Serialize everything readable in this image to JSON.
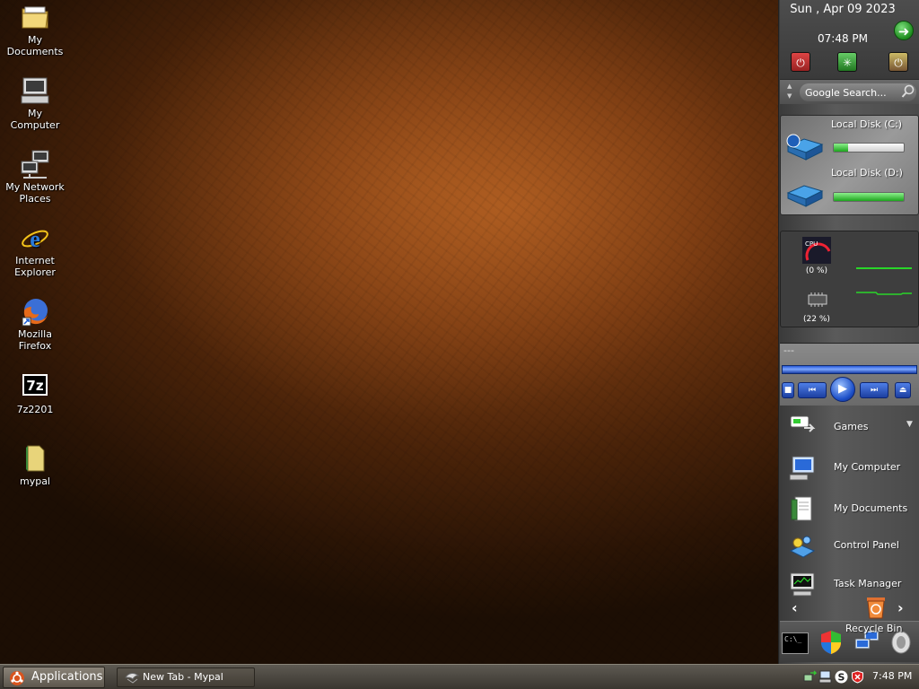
{
  "desktop": {
    "icons": [
      {
        "label": "My\nDocuments",
        "icon": "folder-icon"
      },
      {
        "label": "My\nComputer",
        "icon": "computer-icon"
      },
      {
        "label": "My Network\nPlaces",
        "icon": "network-icon"
      },
      {
        "label": "Internet\nExplorer",
        "icon": "internet-explorer-icon"
      },
      {
        "label": "Mozilla\nFirefox",
        "icon": "firefox-icon"
      },
      {
        "label": "7z2201",
        "icon": "7zip-icon"
      },
      {
        "label": "mypal",
        "icon": "file-icon"
      }
    ]
  },
  "sidebar": {
    "clock": {
      "date": "Sun , Apr 09 2023",
      "time": "07:48 PM"
    },
    "search": {
      "placeholder": "Google Search..."
    },
    "disks": [
      {
        "label": "Local Disk (C:)",
        "used_fraction": 0.2
      },
      {
        "label": "Local Disk (D:)",
        "used_fraction": 1.0
      }
    ],
    "perf": {
      "cpu": "(0 %)",
      "memory": "(22 %)",
      "cpu_badge": "CPU"
    },
    "media": {
      "title": "---"
    },
    "launcher": [
      {
        "label": "Games",
        "icon": "games-icon"
      },
      {
        "label": "My Computer",
        "icon": "computer-icon"
      },
      {
        "label": "My Documents",
        "icon": "documents-icon"
      },
      {
        "label": "Control Panel",
        "icon": "control-panel-icon"
      },
      {
        "label": "Task Manager",
        "icon": "task-manager-icon"
      },
      {
        "label": "Recycle Bin",
        "icon": "recycle-bin-icon"
      }
    ],
    "dock": {
      "terminal_text": "C:\\_"
    }
  },
  "taskbar": {
    "applications_label": "Applications",
    "task_label": "New Tab - Mypal",
    "clock": "7:48 PM"
  },
  "colors": {
    "accent_green": "#29d629",
    "media_blue": "#1c4fc8",
    "taskbar": "#4a463e"
  }
}
